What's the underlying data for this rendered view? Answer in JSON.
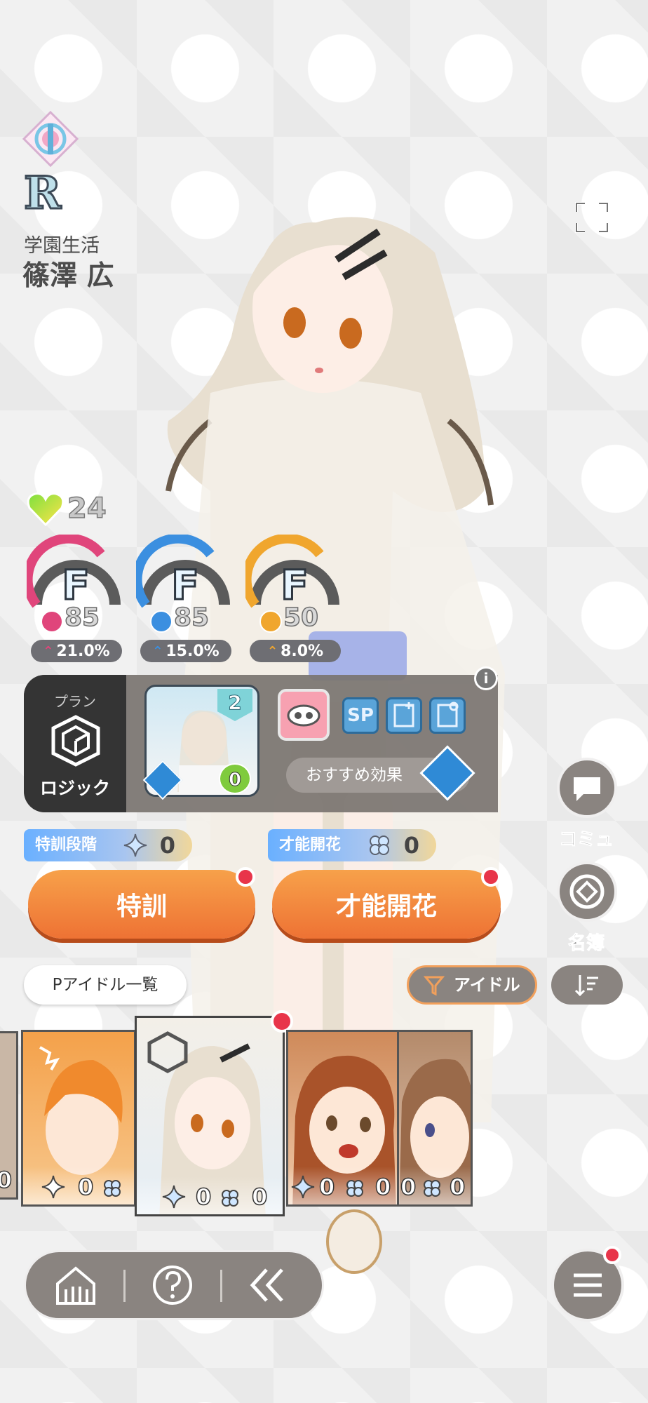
{
  "header": {
    "emblem": "rainbow-emblem-icon",
    "rarity": "R",
    "subtitle": "学園生活",
    "name": "篠澤 広",
    "fullscreen_icon": "fullscreen-icon"
  },
  "stats": {
    "heart": {
      "icon": "heart-icon",
      "value": "24"
    },
    "items": [
      {
        "name": "vocal",
        "grade": "F",
        "value": "85",
        "bonus": "21.0%",
        "color": "#e0457b",
        "icon": "microphone-icon"
      },
      {
        "name": "dance",
        "grade": "F",
        "value": "85",
        "bonus": "15.0%",
        "color": "#3b8fe0",
        "icon": "shoe-icon"
      },
      {
        "name": "visual",
        "grade": "F",
        "value": "50",
        "bonus": "8.0%",
        "color": "#f0a62e",
        "icon": "face-icon"
      }
    ]
  },
  "plan": {
    "label": "プラン",
    "name": "ロジック",
    "icon": "logic-cube-icon"
  },
  "support": {
    "level": "2",
    "count": "0",
    "skills": [
      "SP"
    ],
    "recommend_label": "おすすめ効果",
    "info": "i"
  },
  "training": {
    "tag": "特訓段階",
    "count": "0",
    "button": "特訓"
  },
  "bloom": {
    "tag": "才能開花",
    "count": "0",
    "button": "才能開花"
  },
  "side": {
    "commu": "コミュ",
    "meibo": "名簿"
  },
  "list": {
    "button": "Pアイドル一覧",
    "filter": "アイドル",
    "sort_icon": "sort-icon"
  },
  "cards": [
    {
      "stars": "",
      "clovers": "0"
    },
    {
      "stars": "0",
      "clovers": ""
    },
    {
      "stars": "0",
      "clovers": "0"
    },
    {
      "stars": "0",
      "clovers": "0"
    },
    {
      "stars": "0",
      "clovers": "0"
    }
  ],
  "nav": {
    "home_icon": "home-icon",
    "help_icon": "help-icon",
    "back_icon": "back-icon",
    "menu_icon": "menu-icon"
  },
  "colors": {
    "accent_orange": "#ee7234",
    "panel_gray": "#8a8480",
    "notify_red": "#e8354a"
  }
}
